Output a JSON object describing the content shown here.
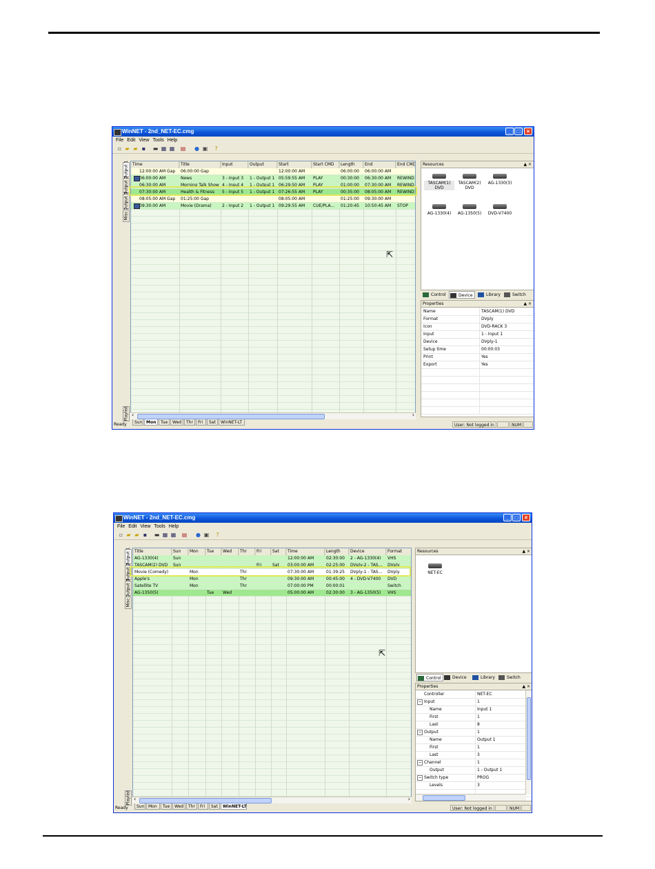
{
  "screen1": {
    "title": "WinNET - 2nd_NET-EC.cmg",
    "menu": [
      "File",
      "Edit",
      "View",
      "Tools",
      "Help"
    ],
    "side_tabs": [
      "Output 1",
      "Output 2",
      "Output 3",
      "Misc"
    ],
    "playlist_label": "Playlist",
    "columns": [
      "Time",
      "Title",
      "Input",
      "Output",
      "Start",
      "Start CMD",
      "Length",
      "End",
      "End CMD"
    ],
    "rows": [
      {
        "cells": [
          "12:00:00 AM Gap",
          "06:00:00 Gap",
          "",
          "",
          "12:00:00 AM",
          "",
          "06:00:00",
          "06:00:00 AM",
          ""
        ],
        "color": "#ffffe0",
        "icon": false
      },
      {
        "cells": [
          "06:00:00 AM",
          "News",
          "3 - Input 3",
          "1 - Output 1",
          "05:59:55 AM",
          "PLAY",
          "00:30:00",
          "06:30:00 AM",
          "REWIND"
        ],
        "color": "#c8f5c0",
        "icon": true
      },
      {
        "cells": [
          "06:30:00 AM",
          "Morning Talk Show",
          "4 - Input 4",
          "1 - Output 1",
          "06:29:50 AM",
          "PLAY",
          "01:00:00",
          "07:30:00 AM",
          "REWIND"
        ],
        "color": "#c8f5c0",
        "icon": false
      },
      {
        "cells": [
          "07:30:00 AM",
          "Health & Fitness",
          "5 - Input 5",
          "1 - Output 1",
          "07:26:55 AM",
          "PLAY",
          "00:35:00",
          "08:05:00 AM",
          "REWIND"
        ],
        "color": "#a0e890",
        "icon": false
      },
      {
        "cells": [
          "08:05:00 AM Gap",
          "01:25:00 Gap",
          "",
          "",
          "08:05:00 AM",
          "",
          "01:25:00",
          "09:30:00 AM",
          ""
        ],
        "color": "#ffffe0",
        "icon": false
      },
      {
        "cells": [
          "09:30:00 AM",
          "Movie (Drama)",
          "2 - Input 2",
          "1 - Output 1",
          "09:29:55 AM",
          "CUE/PLA...",
          "01:20:45",
          "10:50:45 AM",
          "STOP"
        ],
        "color": "#c8f5c0",
        "icon": true
      }
    ],
    "day_tabs": [
      "Sun",
      "Mon",
      "Tue",
      "Wed",
      "Thr",
      "Fri",
      "Sat",
      "WinNET-LT"
    ],
    "active_day": "Mon",
    "resources_title": "Resources",
    "devices": [
      {
        "line1": "TASCAM(1)",
        "line2": "DVD"
      },
      {
        "line1": "TASCAM(2)",
        "line2": "DVD"
      },
      {
        "line1": "AG-1330(3)",
        "line2": ""
      },
      {
        "line1": "AG-1330(4)",
        "line2": ""
      },
      {
        "line1": "AG-1350(5)",
        "line2": ""
      },
      {
        "line1": "DVD-V7400",
        "line2": ""
      }
    ],
    "panel_tabs": [
      "Control",
      "Device",
      "Library",
      "Switch"
    ],
    "active_panel_tab": "Device",
    "properties_title": "Properties",
    "properties": [
      {
        "key": "Name",
        "value": "TASCAM(1) DVD"
      },
      {
        "key": "Format",
        "value": "DVply"
      },
      {
        "key": "Icon",
        "value": "DVD-RACK 3"
      },
      {
        "key": "Input",
        "value": "1 - Input 1"
      },
      {
        "key": "Device",
        "value": "DVply-1"
      },
      {
        "key": "Setup time",
        "value": "00:00:03"
      },
      {
        "key": "Print",
        "value": "Yes"
      },
      {
        "key": "Export",
        "value": "Yes"
      }
    ],
    "status": {
      "ready": "Ready",
      "user": "User:  Not logged in",
      "num": "NUM"
    }
  },
  "screen2": {
    "title": "WinNET - 2nd_NET-EC.cmg",
    "menu": [
      "File",
      "Edit",
      "View",
      "Tools",
      "Help"
    ],
    "side_tabs": [
      "Output 1",
      "Output 2",
      "Output 3",
      "Misc"
    ],
    "playlist_label": "Playlist",
    "columns": [
      "Title",
      "Sun",
      "Mon",
      "Tue",
      "Wed",
      "Thr",
      "Fri",
      "Sat",
      "Time",
      "Length",
      "Device",
      "Format"
    ],
    "rows": [
      {
        "cells": [
          "AG-1330(4)",
          "Sun",
          "",
          "",
          "",
          "",
          "",
          "",
          "12:00:00 AM",
          "02:30:00",
          "2 - AG-1330(4)",
          "VHS"
        ],
        "color": "#c8f5c0"
      },
      {
        "cells": [
          "TASCAM(2) DVD",
          "Sun",
          "",
          "",
          "",
          "",
          "Fri",
          "Sat",
          "03:00:00 AM",
          "02:25:00",
          "DVply-2 - TAS...",
          "DVply"
        ],
        "color": "#c8f5c0"
      },
      {
        "cells": [
          "Movie (Comedy)",
          "",
          "Mon",
          "",
          "",
          "Thr",
          "",
          "",
          "07:30:00 AM",
          "01:39:25",
          "DVply-1 - TAS...",
          "DVply"
        ],
        "color": "#ffffff"
      },
      {
        "cells": [
          "Apple's",
          "",
          "Mon",
          "",
          "",
          "Thr",
          "",
          "",
          "09:30:00 AM",
          "00:45:00",
          "4 - DVD-V7400",
          "DVD"
        ],
        "color": "#c8f5c0"
      },
      {
        "cells": [
          "Satellite TV",
          "",
          "Mon",
          "",
          "",
          "Thr",
          "",
          "",
          "07:00:00 PM",
          "00:00:01",
          "",
          "Switch"
        ],
        "color": "#c8f5c0"
      },
      {
        "cells": [
          "AG-1350(5)",
          "",
          "",
          "Tue",
          "Wed",
          "",
          "",
          "",
          "05:00:00 AM",
          "02:30:00",
          "3 - AG-1350(5)",
          "VHS"
        ],
        "color": "#a0e890"
      }
    ],
    "day_tabs": [
      "Sun",
      "Mon",
      "Tue",
      "Wed",
      "Thr",
      "Fri",
      "Sat",
      "WinNET-LT"
    ],
    "active_day": "WinNET-LT",
    "resources_title": "Resources",
    "devices": [
      {
        "line1": "NET-EC",
        "line2": ""
      }
    ],
    "panel_tabs": [
      "Control",
      "Device",
      "Library",
      "Switch"
    ],
    "active_panel_tab": "Control",
    "properties_title": "Properties",
    "properties": [
      {
        "key": "Controller",
        "value": "NET-EC",
        "indent": 0,
        "group": false
      },
      {
        "key": "Input",
        "value": "1",
        "indent": 0,
        "group": true
      },
      {
        "key": "Name",
        "value": "Input 1",
        "indent": 1,
        "group": false
      },
      {
        "key": "First",
        "value": "1",
        "indent": 1,
        "group": false
      },
      {
        "key": "Last",
        "value": "8",
        "indent": 1,
        "group": false
      },
      {
        "key": "Output",
        "value": "1",
        "indent": 0,
        "group": true
      },
      {
        "key": "Name",
        "value": "Output 1",
        "indent": 1,
        "group": false
      },
      {
        "key": "First",
        "value": "1",
        "indent": 1,
        "group": false
      },
      {
        "key": "Last",
        "value": "3",
        "indent": 1,
        "group": false
      },
      {
        "key": "Channel",
        "value": "1",
        "indent": 0,
        "group": true
      },
      {
        "key": "Output",
        "value": "1 - Output 1",
        "indent": 1,
        "group": false
      },
      {
        "key": "Switch type",
        "value": "PROG",
        "indent": 0,
        "group": true
      },
      {
        "key": "Levels",
        "value": "3",
        "indent": 1,
        "group": false
      }
    ],
    "status": {
      "ready": "Ready",
      "user": "User:  Not logged in",
      "num": "NUM"
    }
  }
}
